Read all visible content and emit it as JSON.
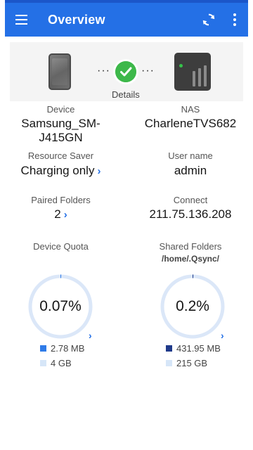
{
  "appbar": {
    "title": "Overview",
    "menu_icon": "hamburger-menu-icon",
    "sync_icon": "sync-icon",
    "more_icon": "more-vert-icon"
  },
  "summary": {
    "details_label": "Details",
    "status_icon": "check-circle-icon"
  },
  "device": {
    "label": "Device",
    "name_line1": "Samsung_SM-",
    "name_line2": "J415GN"
  },
  "nas": {
    "label": "NAS",
    "name": "CharleneTVS682"
  },
  "resource_saver": {
    "label": "Resource Saver",
    "value": "Charging only"
  },
  "user": {
    "label": "User name",
    "value": "admin"
  },
  "paired_folders": {
    "label": "Paired Folders",
    "value": "2"
  },
  "connect": {
    "label": "Connect",
    "value": "211.75.136.208"
  },
  "device_quota": {
    "label": "Device Quota",
    "percent_text": "0.07%",
    "used_fraction": 0.0007,
    "used": "2.78 MB",
    "total": "4 GB"
  },
  "shared_folders": {
    "label": "Shared Folders",
    "path": "/home/.Qsync/",
    "percent_text": "0.2%",
    "used_fraction": 0.002,
    "used": "431.95 MB",
    "total": "215 GB"
  },
  "colors": {
    "appbar": "#2470e6",
    "ring_track": "#dbe7f8",
    "device_used": "#2f7be8",
    "nas_used": "#1f3a8a",
    "free": "#d6e6f8",
    "ok_green": "#3db84a"
  }
}
